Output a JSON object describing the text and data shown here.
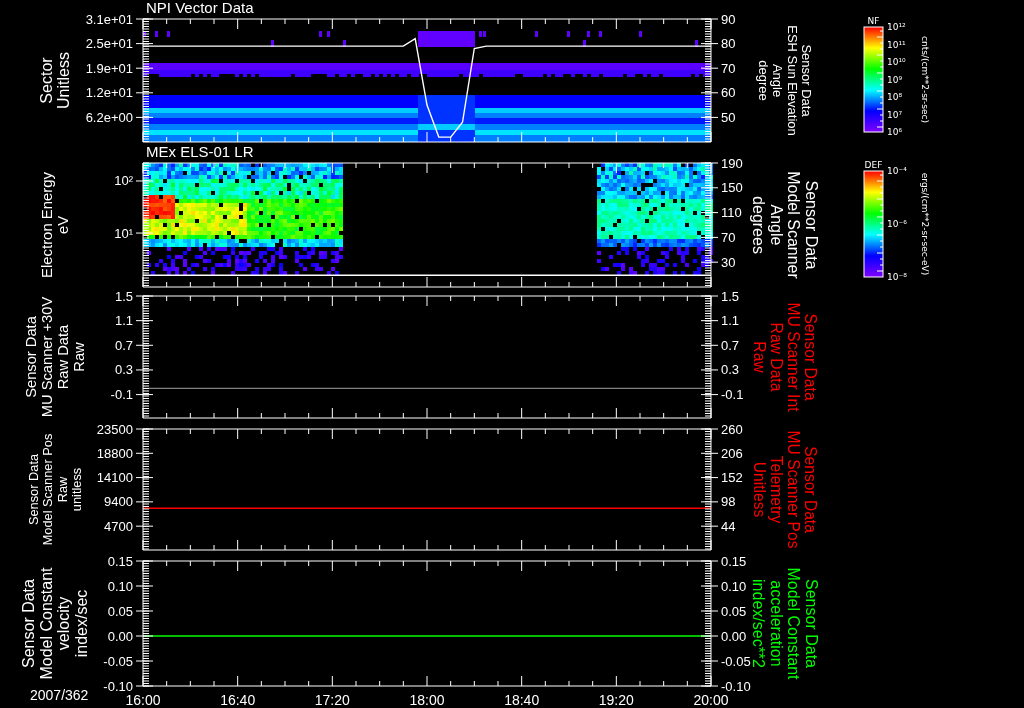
{
  "panels": [
    {
      "kind": "spectrogram",
      "title": "NPI Vector Data",
      "left_axis": {
        "label": [
          "Sector",
          "Unitless"
        ],
        "ticks": [
          "3.1e+01",
          "2.5e+01",
          "1.9e+01",
          "1.2e+01",
          "6.2e+00"
        ]
      },
      "right_axis": {
        "label": [
          "Sensor Data",
          "ESH Sun Elevation",
          "Angle",
          "degree"
        ],
        "color": "#ffffff"
      },
      "chart_data": {
        "type": "line",
        "categories": [
          null,
          null,
          null,
          null,
          null,
          null,
          null,
          null,
          null,
          null,
          null,
          null,
          null,
          null,
          null,
          null,
          null,
          null,
          null,
          null,
          null,
          null,
          null,
          null,
          null,
          null,
          null,
          null,
          null,
          null,
          null,
          null,
          null,
          null,
          null,
          null,
          null,
          null,
          null,
          null,
          null,
          null,
          null,
          null,
          null,
          null,
          null,
          null,
          null
        ],
        "ylim": [
          40,
          90
        ],
        "yticks": [
          {
            "value": 90,
            "label": "90"
          },
          {
            "value": 80,
            "label": "80"
          },
          {
            "value": 70,
            "label": "70"
          },
          {
            "value": 60,
            "label": "60"
          },
          {
            "value": 50,
            "label": "50"
          }
        ],
        "series": [
          {
            "color": "#ffffff",
            "values": [
              79,
              79,
              79,
              79,
              79,
              79,
              79,
              79,
              79,
              79,
              79,
              79,
              79,
              79,
              79,
              79,
              79,
              79,
              79,
              79,
              79,
              79,
              79,
              82,
              55,
              42,
              42,
              48,
              78,
              79,
              79,
              79,
              79,
              79,
              79,
              79,
              79,
              79,
              79,
              79,
              79,
              79,
              79,
              79,
              79,
              79,
              79,
              79,
              79
            ]
          }
        ]
      },
      "colorbar": {
        "title": "NF",
        "ticks": [
          "10¹²",
          "10¹¹",
          "10¹⁰",
          "10⁹",
          "10⁸",
          "10⁷",
          "10⁶"
        ],
        "units": "cnts/(cm**2-sr-sec)"
      }
    },
    {
      "kind": "spectrogram",
      "title": "MEx ELS-01 LR",
      "left_axis": {
        "label": [
          "Electron Energy",
          "eV"
        ],
        "ticks": [
          "10²",
          "10¹"
        ]
      },
      "right_axis": {
        "label": [
          "Sensor Data",
          "Model Scanner",
          "Angle",
          "degrees"
        ],
        "color": "#ffffff"
      },
      "chart_data": {
        "type": "line",
        "categories": [
          null,
          null,
          null,
          null,
          null
        ],
        "ylim": [
          -10,
          190
        ],
        "yticks": [
          {
            "value": 190,
            "label": "190"
          },
          {
            "value": 150,
            "label": "150"
          },
          {
            "value": 110,
            "label": "110"
          },
          {
            "value": 70,
            "label": "70"
          },
          {
            "value": 30,
            "label": "30"
          }
        ],
        "series": [
          {
            "color": "#ffffff",
            "values": [
              9,
              9,
              9,
              9,
              9
            ]
          }
        ]
      },
      "colorbar": {
        "title": "DEF",
        "ticks": [
          "10⁻⁴",
          "10⁻⁶",
          "10⁻⁸"
        ],
        "units": "ergs/(cm**2-sr-sec-eV)"
      }
    },
    {
      "kind": "line",
      "left_axis": {
        "label": [
          "Sensor Data",
          "MU Scanner +30V",
          "Raw Data",
          "Raw"
        ],
        "ticks": [
          "1.5",
          "1.1",
          "0.7",
          "0.3",
          "-0.1"
        ]
      },
      "right_axis": {
        "label": [
          "Sensor Data",
          "MU Scanner Int",
          "Raw Data",
          "Raw"
        ],
        "color": "#ff0000"
      },
      "chart_data": {
        "type": "line",
        "categories": [
          null,
          null,
          null,
          null,
          null
        ],
        "ylim": [
          -0.48,
          1.5
        ],
        "yticks": [
          {
            "value": 1.5,
            "label": "1.5"
          },
          {
            "value": 1.1,
            "label": "1.1"
          },
          {
            "value": 0.7,
            "label": "0.7"
          },
          {
            "value": 0.3,
            "label": "0.3"
          },
          {
            "value": -0.1,
            "label": "-0.1"
          }
        ],
        "series": [
          {
            "color": "#808080",
            "values": [
              0,
              0,
              0,
              0,
              0
            ]
          }
        ]
      }
    },
    {
      "kind": "line",
      "left_axis": {
        "label": [
          "Sensor Data",
          "Model Scanner Pos",
          "Raw",
          "unitless"
        ],
        "ticks": [
          "23500",
          "18800",
          "14100",
          "9400",
          "4700"
        ]
      },
      "right_axis": {
        "label": [
          "Sensor Data",
          "MU Scanner Pos",
          "Telemetry",
          "Unitless"
        ],
        "color": "#ff0000"
      },
      "chart_data": {
        "type": "line",
        "categories": [
          null,
          null,
          null,
          null,
          null
        ],
        "ylim": [
          -9,
          260
        ],
        "yticks": [
          {
            "value": 260,
            "label": "260"
          },
          {
            "value": 206,
            "label": "206"
          },
          {
            "value": 152,
            "label": "152"
          },
          {
            "value": 98,
            "label": "98"
          },
          {
            "value": 44,
            "label": "44"
          }
        ],
        "series": [
          {
            "color": "#ff0000",
            "values": [
              84,
              84,
              84,
              84,
              84
            ]
          }
        ]
      }
    },
    {
      "kind": "line",
      "left_axis": {
        "label": [
          "Sensor Data",
          "Model Constant",
          "velocity",
          "index/sec"
        ],
        "ticks": [
          "0.15",
          "0.10",
          "0.05",
          "0.00",
          "-0.05",
          "-0.10"
        ]
      },
      "right_axis": {
        "label": [
          "Sensor Data",
          "Model Constant",
          "acceleration",
          "index/sec**2"
        ],
        "color": "#00ff00"
      },
      "chart_data": {
        "type": "line",
        "categories": [
          null,
          null,
          null,
          null,
          null
        ],
        "ylim": [
          -0.1,
          0.15
        ],
        "yticks": [
          {
            "value": 0.15,
            "label": "0.15"
          },
          {
            "value": 0.1,
            "label": "0.10"
          },
          {
            "value": 0.05,
            "label": "0.05"
          },
          {
            "value": 0,
            "label": "0.00"
          },
          {
            "value": -0.05,
            "label": "-0.05"
          },
          {
            "value": -0.1,
            "label": "-0.10"
          }
        ],
        "series": [
          {
            "color": "#00ff00",
            "values": [
              0,
              0,
              0,
              0,
              0
            ]
          }
        ]
      }
    }
  ],
  "time_axis": {
    "date": "2007/362",
    "ticks": [
      "16:00",
      "16:40",
      "17:20",
      "18:00",
      "18:40",
      "19:20",
      "20:00"
    ]
  }
}
